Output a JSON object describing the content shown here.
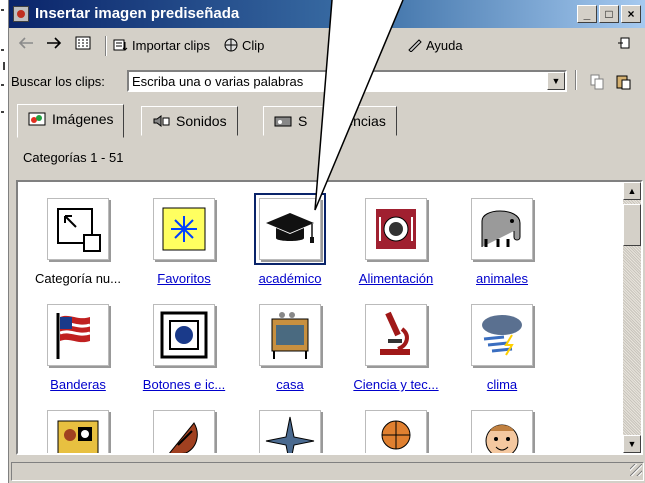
{
  "window": {
    "title": "Insertar imagen prediseñada",
    "controls": {
      "minimize": "_",
      "maximize": "□",
      "close": "×"
    }
  },
  "toolbar": {
    "back_icon": "back-arrow-icon",
    "forward_icon": "forward-arrow-icon",
    "grid_icon": "grid-view-icon",
    "import_label": "Importar clips",
    "import_underline": "I",
    "clips_label": "Clip",
    "help_label": "Ayuda",
    "help_underline": "u",
    "extra_icon": "pin-icon"
  },
  "search": {
    "label": "Buscar los clips:",
    "value": "Escriba una o varias palabras",
    "copy_icon": "copy-icon",
    "paste_icon": "paste-icon"
  },
  "tabs": [
    {
      "label": "Imágenes",
      "underline": "I",
      "active": true,
      "icon": "images-icon"
    },
    {
      "label": "Sonidos",
      "underline": "S",
      "active": false,
      "icon": "sounds-icon"
    },
    {
      "label": "S",
      "label_tail": "encias",
      "active": false,
      "icon": "videos-icon"
    }
  ],
  "category_count": "Categorías 1 - 51",
  "categories": [
    {
      "label": "Categoría nu...",
      "icon": "new-category-icon",
      "link": false,
      "selected": false
    },
    {
      "label": "Favoritos",
      "icon": "star-icon",
      "link": true,
      "selected": false
    },
    {
      "label": "académico",
      "icon": "graduation-cap-icon",
      "link": true,
      "selected": true
    },
    {
      "label": "Alimentación",
      "icon": "plate-icon",
      "link": true,
      "selected": false
    },
    {
      "label": "animales",
      "icon": "elephant-icon",
      "link": true,
      "selected": false
    },
    {
      "label": "Banderas",
      "icon": "flag-icon",
      "link": true,
      "selected": false
    },
    {
      "label": "Botones e ic...",
      "icon": "button-icon",
      "link": true,
      "selected": false
    },
    {
      "label": "casa",
      "icon": "kitchen-icon",
      "link": true,
      "selected": false
    },
    {
      "label": "Ciencia y tec...",
      "icon": "microscope-icon",
      "link": true,
      "selected": false
    },
    {
      "label": "clima",
      "icon": "storm-cloud-icon",
      "link": true,
      "selected": false
    },
    {
      "label": "",
      "icon": "people-icon",
      "link": false,
      "selected": false
    },
    {
      "label": "",
      "icon": "satellite-dish-icon",
      "link": false,
      "selected": false
    },
    {
      "label": "",
      "icon": "compass-rose-icon",
      "link": false,
      "selected": false
    },
    {
      "label": "",
      "icon": "basketball-icon",
      "link": false,
      "selected": false
    },
    {
      "label": "",
      "icon": "child-face-icon",
      "link": false,
      "selected": false
    }
  ],
  "colors": {
    "titlebar_start": "#0a246a",
    "titlebar_end": "#a6caf0",
    "window_face": "#d4d0c8",
    "link": "#0000cc"
  }
}
